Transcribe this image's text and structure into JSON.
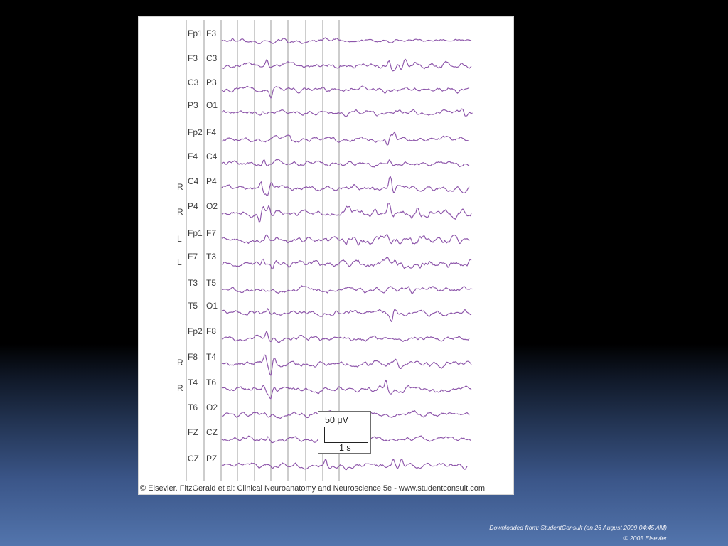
{
  "figure": {
    "channels": [
      {
        "a": "Fp1",
        "b": "F3"
      },
      {
        "a": "F3",
        "b": "C3"
      },
      {
        "a": "C3",
        "b": "P3"
      },
      {
        "a": "P3",
        "b": "O1"
      },
      {
        "a": "Fp2",
        "b": "F4"
      },
      {
        "a": "F4",
        "b": "C4"
      },
      {
        "side": "R",
        "a": "C4",
        "b": "P4"
      },
      {
        "side": "R",
        "a": "P4",
        "b": "O2"
      },
      {
        "side": "L",
        "a": "Fp1",
        "b": "F7"
      },
      {
        "side": "L",
        "a": "F7",
        "b": "T3"
      },
      {
        "a": "T3",
        "b": "T5"
      },
      {
        "a": "T5",
        "b": "O1"
      },
      {
        "a": "Fp2",
        "b": "F8"
      },
      {
        "side": "R",
        "a": "F8",
        "b": "T4"
      },
      {
        "side": "R",
        "a": "T4",
        "b": "T6"
      },
      {
        "a": "T6",
        "b": "O2"
      },
      {
        "a": "FZ",
        "b": "CZ"
      },
      {
        "a": "CZ",
        "b": "PZ"
      }
    ],
    "calibration": {
      "amplitude": "50 μV",
      "time": "1 s"
    },
    "caption": "© Elsevier. FitzGerald et al: Clinical Neuroanatomy and Neuroscience 5e - www.studentconsult.com"
  },
  "footer": {
    "source": "Downloaded from: StudentConsult (on 26 August 2009 04:45 AM)",
    "copyright": "© 2005 Elsevier"
  },
  "colors": {
    "trace": "#8d55aa",
    "grid": "#9b9b9b",
    "panel": "#ffffff"
  }
}
